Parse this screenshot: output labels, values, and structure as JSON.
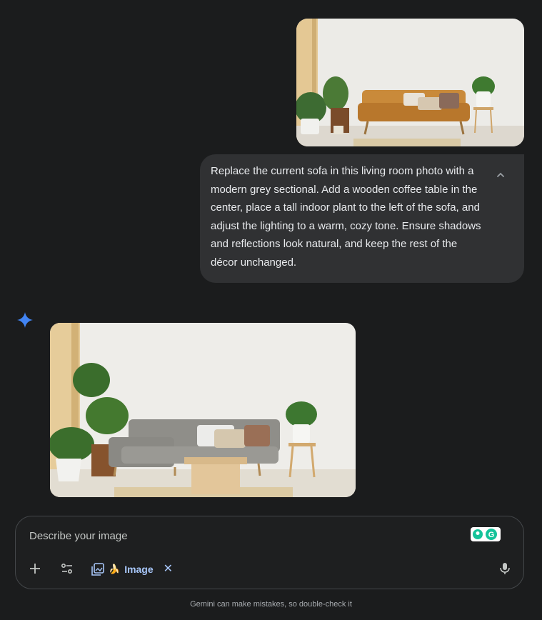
{
  "conversation": {
    "user_prompt": "Replace the current sofa in this living room photo with a modern grey sectional. Add a wooden coffee table in the center, place a tall indoor plant to the left of the sofa, and adjust the lighting to a warm, cozy tone. Ensure shadows and reflections look natural, and keep the rest of the décor unchanged.",
    "user_image_icon": "living-room-orange-sofa-image",
    "response_image_icon": "living-room-grey-sectional-image",
    "collapse_icon": "chevron-up-icon",
    "assistant_icon": "gemini-sparkle-icon"
  },
  "input": {
    "placeholder": "Describe your image",
    "add_icon": "plus-icon",
    "tools_icon": "sliders-icon",
    "tool_chip": {
      "label": "Image",
      "icon": "image-gallery-icon",
      "emoji": "🍌",
      "remove_label": "✕"
    },
    "mic_icon": "microphone-icon",
    "grammarly_icon": "grammarly-icon"
  },
  "footer": {
    "disclaimer": "Gemini can make mistakes, so double-check it"
  },
  "colors": {
    "background": "#1b1c1d",
    "bubble": "#303133",
    "accent": "#a8c7fa",
    "gemini_blue": "#4285f4"
  }
}
